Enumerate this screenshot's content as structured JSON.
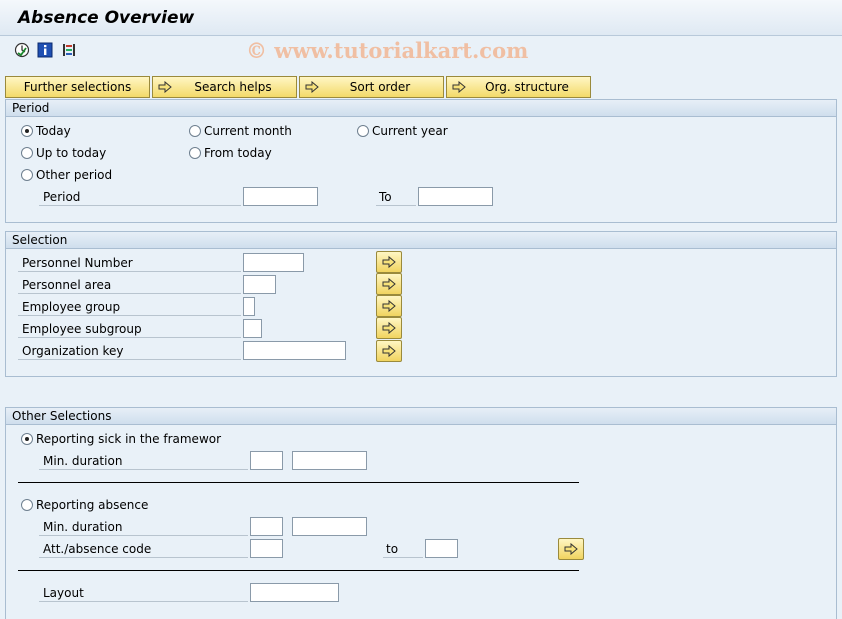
{
  "header": {
    "title": "Absence Overview"
  },
  "watermark": "© www.tutorialkart.com",
  "toolbar": {
    "icons": [
      "execute-icon",
      "info-icon",
      "variant-icon"
    ],
    "buttons": [
      {
        "label": "Further selections"
      },
      {
        "label": "Search helps"
      },
      {
        "label": "Sort order"
      },
      {
        "label": "Org. structure"
      }
    ]
  },
  "period": {
    "title": "Period",
    "options": {
      "today": "Today",
      "current_month": "Current month",
      "current_year": "Current year",
      "up_to_today": "Up to today",
      "from_today": "From today",
      "other_period": "Other period"
    },
    "selected": "today",
    "period_label": "Period",
    "to_label": "To",
    "from_value": "",
    "to_value": ""
  },
  "selection": {
    "title": "Selection",
    "fields": {
      "personnel_number": {
        "label": "Personnel Number",
        "value": ""
      },
      "personnel_area": {
        "label": "Personnel area",
        "value": ""
      },
      "employee_group": {
        "label": "Employee group",
        "value": ""
      },
      "employee_subgroup": {
        "label": "Employee subgroup",
        "value": ""
      },
      "organization_key": {
        "label": "Organization key",
        "value": ""
      }
    }
  },
  "other": {
    "title": "Other Selections",
    "reporting_sick": "Reporting sick in the framewor",
    "reporting_absence": "Reporting absence",
    "min_duration": "Min. duration",
    "att_absence_code": "Att./absence code",
    "to_label": "to",
    "layout": "Layout",
    "selected": "reporting_sick"
  },
  "colors": {
    "background": "#e9f1f8",
    "button_yellow": "#f3da6a",
    "group_border": "#a9bdd1"
  }
}
